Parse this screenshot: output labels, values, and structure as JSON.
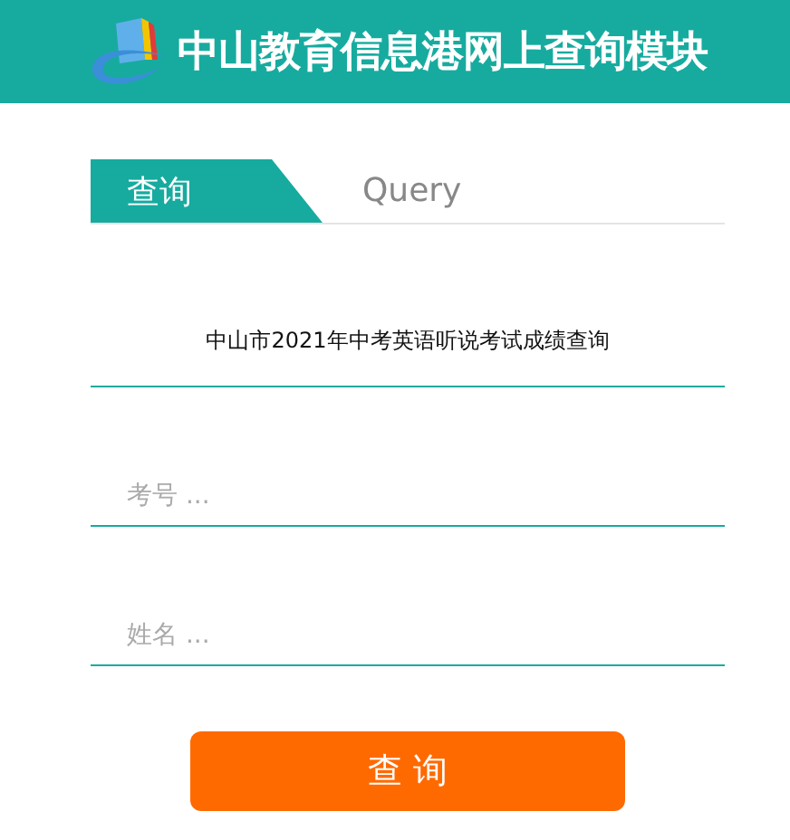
{
  "header": {
    "title": "中山教育信息港网上查询模块"
  },
  "tabs": [
    {
      "label": "查询",
      "selected": true
    },
    {
      "label": "Query",
      "selected": false
    }
  ],
  "form": {
    "subtitle": "中山市2021年中考英语听说考试成绩查询",
    "fields": [
      {
        "placeholder": "考号 ..."
      },
      {
        "placeholder": "姓名 ..."
      }
    ],
    "submit": "查 询"
  }
}
